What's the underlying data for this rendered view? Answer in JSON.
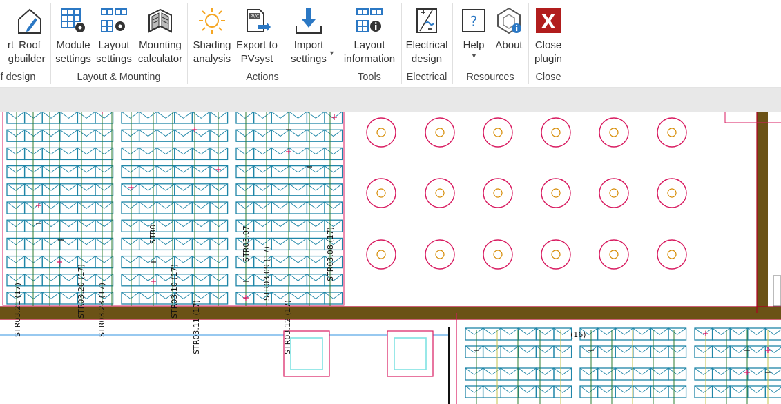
{
  "ribbon": {
    "groups": {
      "roof_design": {
        "label": "f design"
      },
      "layout_mounting": {
        "label": "Layout & Mounting"
      },
      "actions": {
        "label": "Actions"
      },
      "tools": {
        "label": "Tools"
      },
      "electrical": {
        "label": "Electrical"
      },
      "resources": {
        "label": "Resources"
      },
      "close": {
        "label": "Close"
      }
    },
    "buttons": {
      "partial": {
        "line1": "rt",
        "line2": "g"
      },
      "roof_builder": {
        "line1": "Roof",
        "line2": "builder",
        "icon": "roof-builder-icon"
      },
      "module_settings": {
        "line1": "Module",
        "line2": "settings",
        "icon": "module-settings-icon"
      },
      "layout_settings": {
        "line1": "Layout",
        "line2": "settings",
        "icon": "layout-settings-icon"
      },
      "mounting_calculator": {
        "line1": "Mounting",
        "line2": "calculator",
        "icon": "mounting-calculator-icon"
      },
      "shading_analysis": {
        "line1": "Shading",
        "line2": "analysis",
        "icon": "sun-icon"
      },
      "export_pvsyst": {
        "line1": "Export to",
        "line2": "PVsyst",
        "icon": "export-pvc-icon",
        "badge": "PVC"
      },
      "import_settings": {
        "line1": "Import",
        "line2": "settings",
        "icon": "import-icon"
      },
      "layout_information": {
        "line1": "Layout",
        "line2": "information",
        "icon": "layout-info-icon"
      },
      "electrical_design": {
        "line1": "Electrical",
        "line2": "design",
        "icon": "electrical-design-icon"
      },
      "help": {
        "line1": "Help",
        "icon": "help-icon",
        "glyph": "?"
      },
      "about": {
        "line1": "About",
        "icon": "about-icon"
      },
      "close_plugin": {
        "line1": "Close",
        "line2": "plugin",
        "icon": "close-icon",
        "glyph": "X"
      }
    }
  },
  "drawing": {
    "string_labels": [
      "STR03.21 (17)",
      "STR03.20 (17)",
      "STR03.23 (17)",
      "STR03.10 (17)",
      "STR03.11 (17)",
      "STR03.09 (17)",
      "STR03.12 (17)",
      "STR03.08 (17)",
      "STR0",
      "STR03.07"
    ],
    "count_label": "(16)"
  },
  "colors": {
    "module_blue": "#1f86a8",
    "wire_green": "#2e7d32",
    "pink_outline": "#d81b60",
    "beam_brown": "#6b5216",
    "accent_blue": "#2b78c4",
    "close_red": "#b11d1d"
  }
}
